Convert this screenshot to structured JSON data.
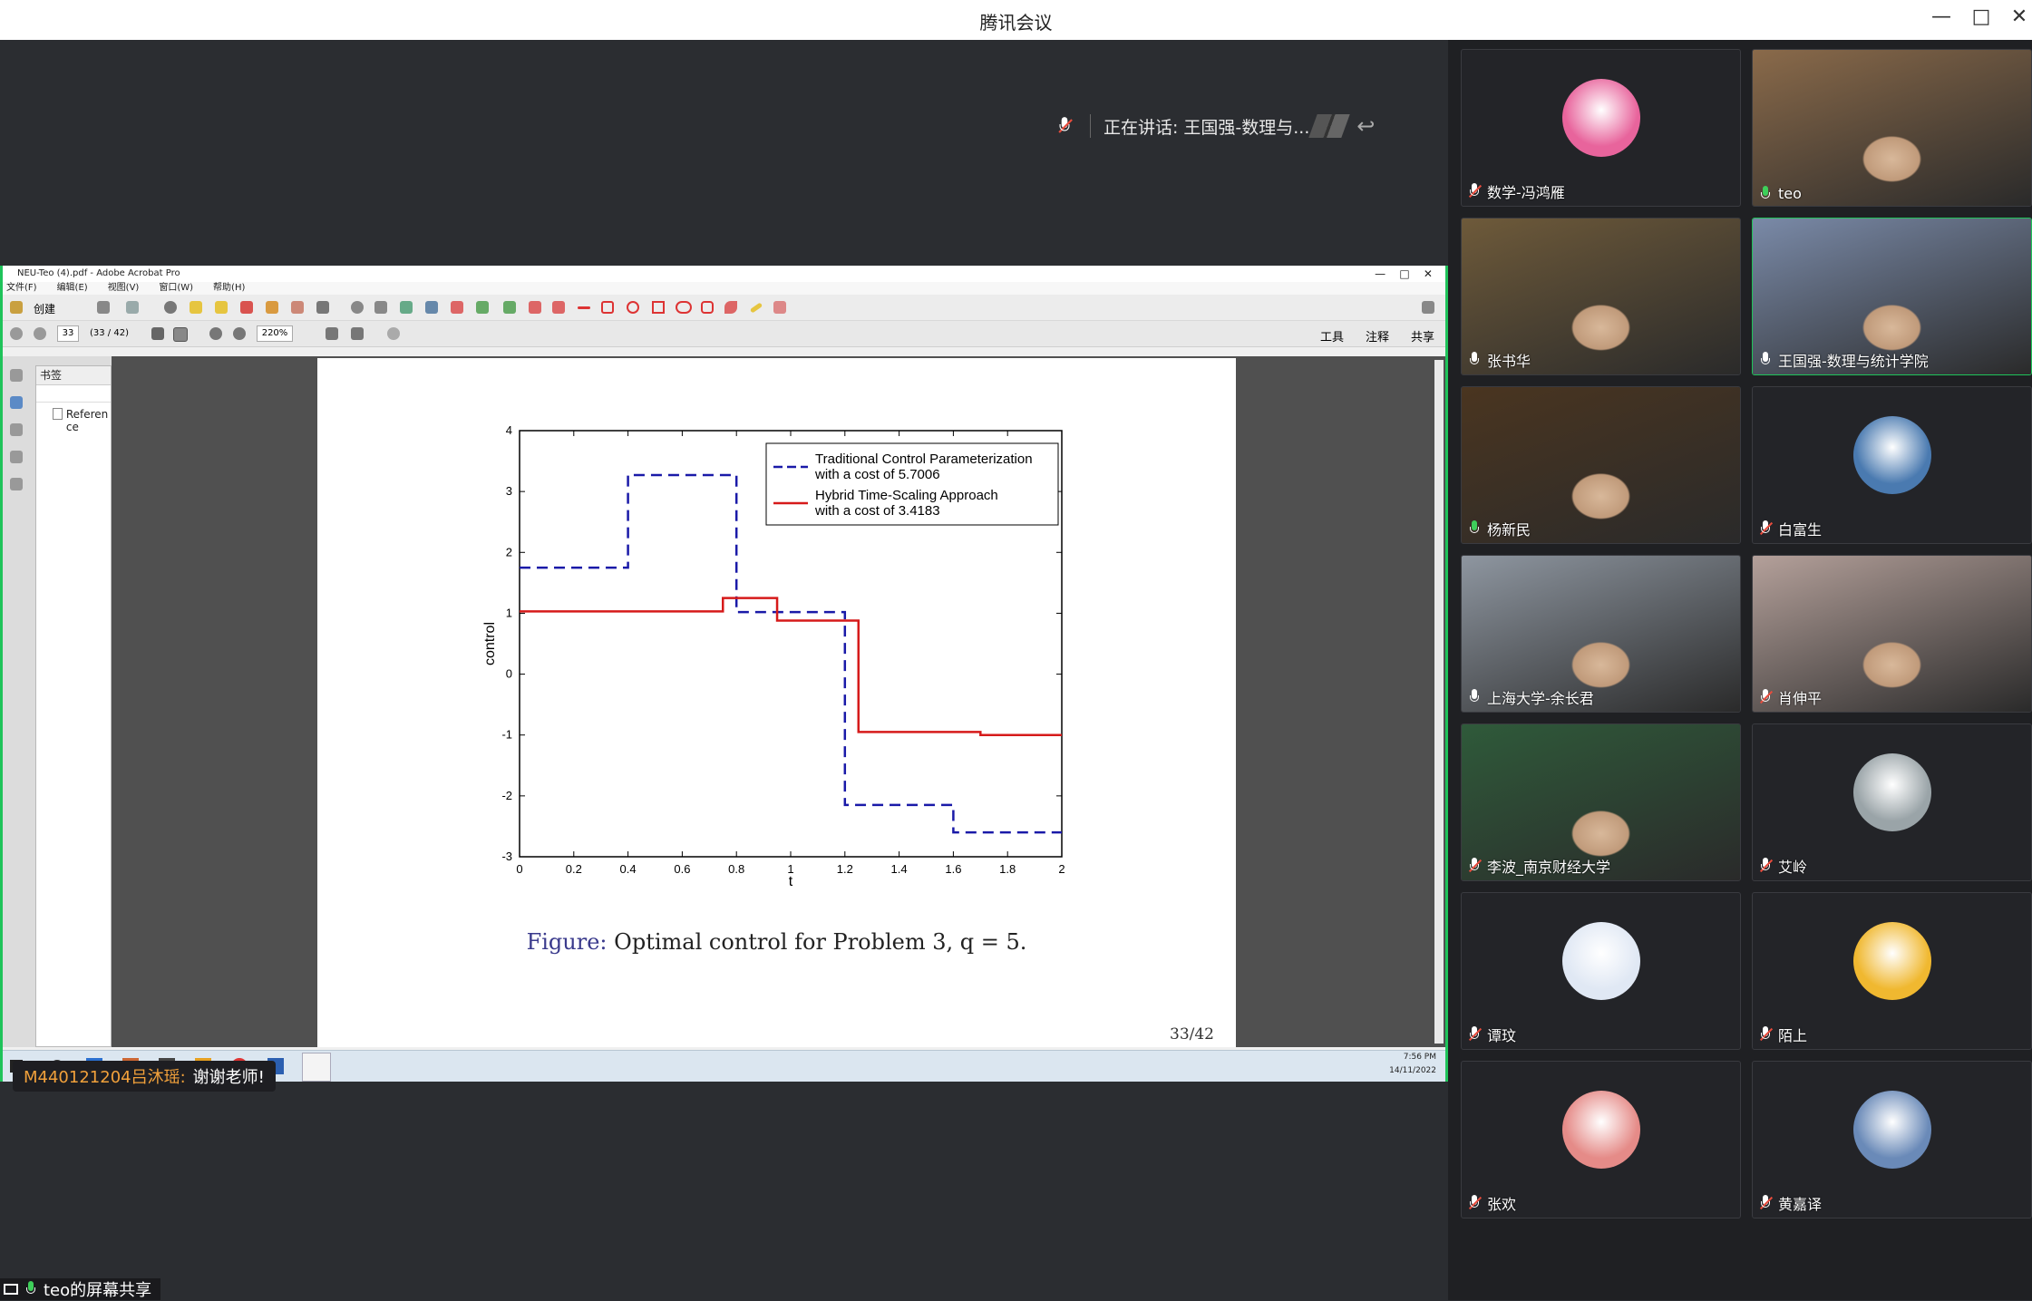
{
  "app": {
    "title": "腾讯会议",
    "speaking_prefix": "正在讲话:",
    "speaking_name": "王国强-数理与...",
    "share_label": "teo的屏幕共享"
  },
  "colors": {
    "share_border": "#1fc35a",
    "mic_active": "#3ecf5a",
    "mic_muted": "#e84c3d",
    "chat_sender": "#f2a13b"
  },
  "chat": {
    "sender": "M440121204吕沐瑶:",
    "message": "谢谢老师!"
  },
  "participants": [
    {
      "name": "数学-冯鸿雁",
      "mic": "muted",
      "view": "avatar",
      "avatar_color": "#e8649c"
    },
    {
      "name": "teo",
      "mic": "active",
      "view": "video",
      "avatar_color": "#8a6a4a"
    },
    {
      "name": "张书华",
      "mic": "neutral",
      "view": "video",
      "avatar_color": "#6e5a3a"
    },
    {
      "name": "王国强-数理与统计学院",
      "mic": "neutral",
      "view": "video",
      "avatar_color": "#7a8aa8"
    },
    {
      "name": "杨新民",
      "mic": "active",
      "view": "video",
      "avatar_color": "#4a3520"
    },
    {
      "name": "白富生",
      "mic": "muted",
      "view": "avatar",
      "avatar_color": "#4a7ab0"
    },
    {
      "name": "上海大学-余长君",
      "mic": "neutral",
      "view": "video",
      "avatar_color": "#8e96a0"
    },
    {
      "name": "肖伸平",
      "mic": "muted",
      "view": "video",
      "avatar_color": "#b4a09a"
    },
    {
      "name": "李波_南京财经大学",
      "mic": "muted",
      "view": "video",
      "avatar_color": "#2f5a3a"
    },
    {
      "name": "艾岭",
      "mic": "muted",
      "view": "avatar",
      "avatar_color": "#9aa4a8"
    },
    {
      "name": "谭玟",
      "mic": "muted",
      "view": "avatar",
      "avatar_color": "#e0e8f4"
    },
    {
      "name": "陌上",
      "mic": "muted",
      "view": "avatar",
      "avatar_color": "#f0b830"
    },
    {
      "name": "张欢",
      "mic": "muted",
      "view": "avatar",
      "avatar_color": "#e58b88"
    },
    {
      "name": "黄嘉译",
      "mic": "muted",
      "view": "avatar",
      "avatar_color": "#6a8ab8"
    }
  ],
  "acrobat": {
    "title": "NEU-Teo (4).pdf - Adobe Acrobat Pro",
    "menu": [
      "文件(F)",
      "编辑(E)",
      "视图(V)",
      "窗口(W)",
      "帮助(H)"
    ],
    "create_label": "创建",
    "page_input": "33",
    "page_count": "(33 / 42)",
    "zoom": "220%",
    "right_tools": [
      "工具",
      "注释",
      "共享"
    ],
    "panel_title": "书签",
    "bookmark_item": "Referen ce",
    "caption_label": "Figure:",
    "caption_text": "Optimal control for Problem 3, q = 5.",
    "page_number": "33/42",
    "clock_time": "7:56 PM",
    "clock_date": "14/11/2022"
  },
  "chart_data": {
    "type": "line",
    "step": true,
    "xlabel": "t",
    "ylabel": "control",
    "xlim": [
      0,
      2
    ],
    "ylim": [
      -3,
      4
    ],
    "x_ticks": [
      "0",
      "0.2",
      "0.4",
      "0.6",
      "0.8",
      "1",
      "1.2",
      "1.4",
      "1.6",
      "1.8",
      "2"
    ],
    "y_ticks": [
      "4",
      "3",
      "2",
      "1",
      "0",
      "-1",
      "-2",
      "-3"
    ],
    "legend_position": "top-right",
    "series": [
      {
        "name": "Traditional Control Parameterization with a cost of 5.7006",
        "legend_lines": [
          "Traditional Control Parameterization",
          "with a cost of 5.7006"
        ],
        "color": "#1a1aa8",
        "dashed": true,
        "x": [
          0,
          0.4,
          0.4,
          0.8,
          0.8,
          1.2,
          1.2,
          1.6,
          1.6,
          2.0
        ],
        "y": [
          1.75,
          1.75,
          3.27,
          3.27,
          1.02,
          1.02,
          -2.15,
          -2.15,
          -2.6,
          -2.6
        ]
      },
      {
        "name": "Hybrid Time-Scaling Approach with a cost of 3.4183",
        "legend_lines": [
          "Hybrid Time-Scaling Approach",
          "with a cost of 3.4183"
        ],
        "color": "#d61a1a",
        "dashed": false,
        "x": [
          0,
          0.75,
          0.75,
          0.95,
          0.95,
          1.25,
          1.25,
          1.7,
          1.7,
          2.0
        ],
        "y": [
          1.03,
          1.03,
          1.25,
          1.25,
          0.88,
          0.88,
          -0.95,
          -0.95,
          -1.0,
          -1.0
        ]
      }
    ]
  }
}
